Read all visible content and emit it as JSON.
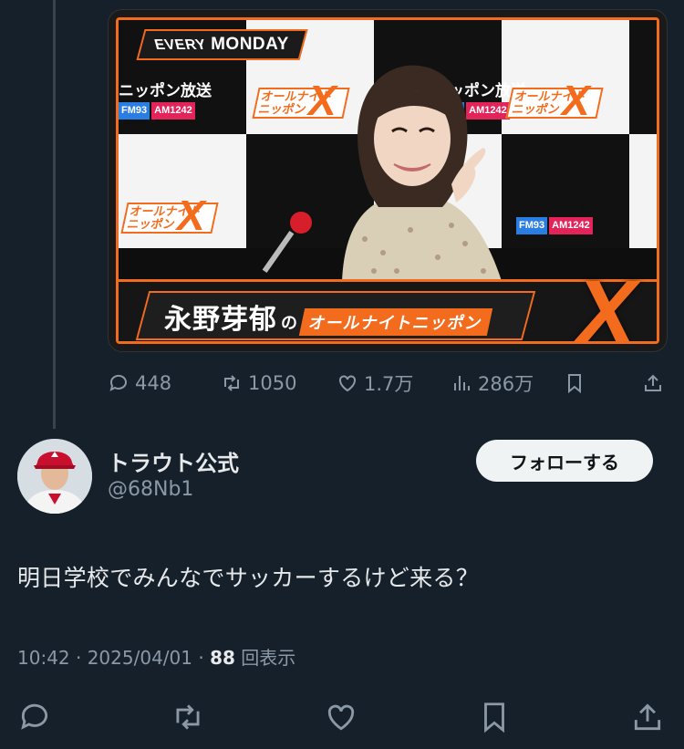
{
  "media": {
    "badge_every": "EVERY",
    "badge_day": "MONDAY",
    "station_name": "ニッポン放送",
    "station_fm": "FM93",
    "station_am": "AM1242",
    "show_logo_text": "オールナイトニッポン",
    "show_logo_x": "X",
    "host_name": "永野芽郁",
    "particle": "の",
    "title_show": "オールナイトニッポン",
    "colors": {
      "accent": "#f36b1c",
      "fm": "#2a7de1",
      "am": "#e2245a"
    }
  },
  "top_actions": {
    "replies": "448",
    "retweets": "1050",
    "likes": "1.7万",
    "views": "286万"
  },
  "tweet": {
    "display_name": "トラウト公式",
    "handle": "@68Nb1",
    "follow_label": "フォローする",
    "text": "明日学校でみんなでサッカーするけど来る？",
    "time": "10:42 · 2025/04/01 · ",
    "view_count": "88",
    "view_suffix": " 回表示"
  },
  "theme": {
    "background": "#15202b",
    "text": "#e7e9ea",
    "muted": "#8b98a5"
  }
}
